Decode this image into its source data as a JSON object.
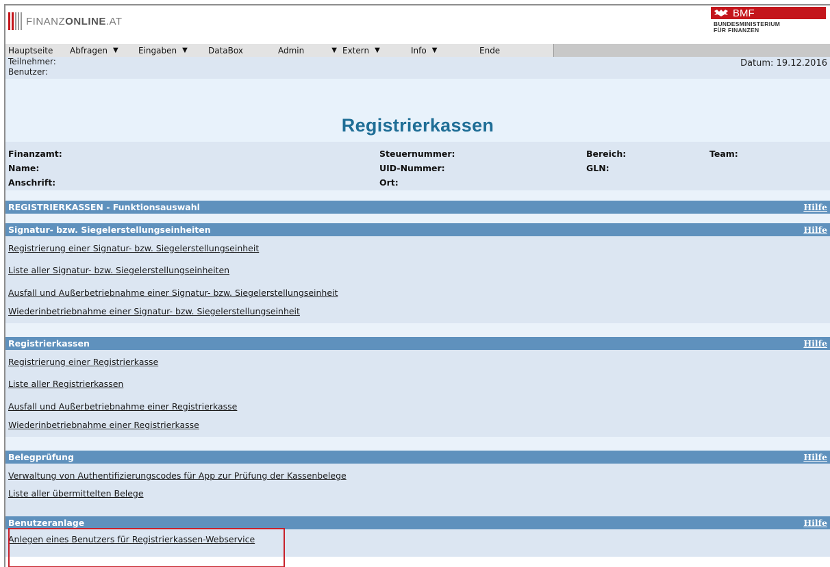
{
  "brand": {
    "logo_text_light": "FINANZ",
    "logo_text_bold": "ONLINE",
    "logo_text_tld": ".AT",
    "ministry_short": "BMF",
    "ministry_long_1": "BUNDESMINISTERIUM",
    "ministry_long_2": "FÜR FINANZEN",
    "accent": "#c4161c"
  },
  "menu": [
    {
      "label": "Hauptseite",
      "dropdown": false
    },
    {
      "label": "Abfragen",
      "dropdown": true
    },
    {
      "label": "Eingaben",
      "dropdown": true
    },
    {
      "label": "DataBox",
      "dropdown": false
    },
    {
      "label": "Admin",
      "dropdown": true
    },
    {
      "label": "Extern",
      "dropdown": true
    },
    {
      "label": "Info",
      "dropdown": true
    },
    {
      "label": "Ende",
      "dropdown": false
    }
  ],
  "user": {
    "participant_label": "Teilnehmer:",
    "user_label": "Benutzer:",
    "date": "Datum: 19.12.2016"
  },
  "page_title": "Registrierkassen",
  "meta": {
    "finanzamt": "Finanzamt:",
    "name": "Name:",
    "anschrift": "Anschrift:",
    "steuernummer": "Steuernummer:",
    "uid": "UID-Nummer:",
    "ort": "Ort:",
    "bereich": "Bereich:",
    "gln": "GLN:",
    "team": "Team:"
  },
  "help_label": "Hilfe",
  "sections": {
    "function_select": {
      "title": "REGISTRIERKASSEN - Funktionsauswahl"
    },
    "signature": {
      "title": "Signatur- bzw. Siegelerstellungseinheiten",
      "links": [
        "Registrierung einer Signatur- bzw. Siegelerstellungseinheit",
        "Liste aller Signatur- bzw. Siegelerstellungseinheiten",
        "Ausfall und Außerbetriebnahme einer Signatur- bzw. Siegelerstellungseinheit",
        "Wiederinbetriebnahme einer Signatur- bzw. Siegelerstellungseinheit"
      ]
    },
    "registers": {
      "title": "Registrierkassen",
      "links": [
        "Registrierung einer Registrierkasse",
        "Liste aller Registrierkassen",
        "Ausfall und Außerbetriebnahme einer Registrierkasse",
        "Wiederinbetriebnahme einer Registrierkasse"
      ]
    },
    "receipt_check": {
      "title": "Belegprüfung",
      "links": [
        "Verwaltung von Authentifizierungscodes für App zur Prüfung der Kassenbelege",
        "Liste aller übermittelten Belege"
      ]
    },
    "user_setup": {
      "title": "Benutzeranlage",
      "links": [
        "Anlegen eines Benutzers für Registrierkassen-Webservice"
      ]
    }
  }
}
